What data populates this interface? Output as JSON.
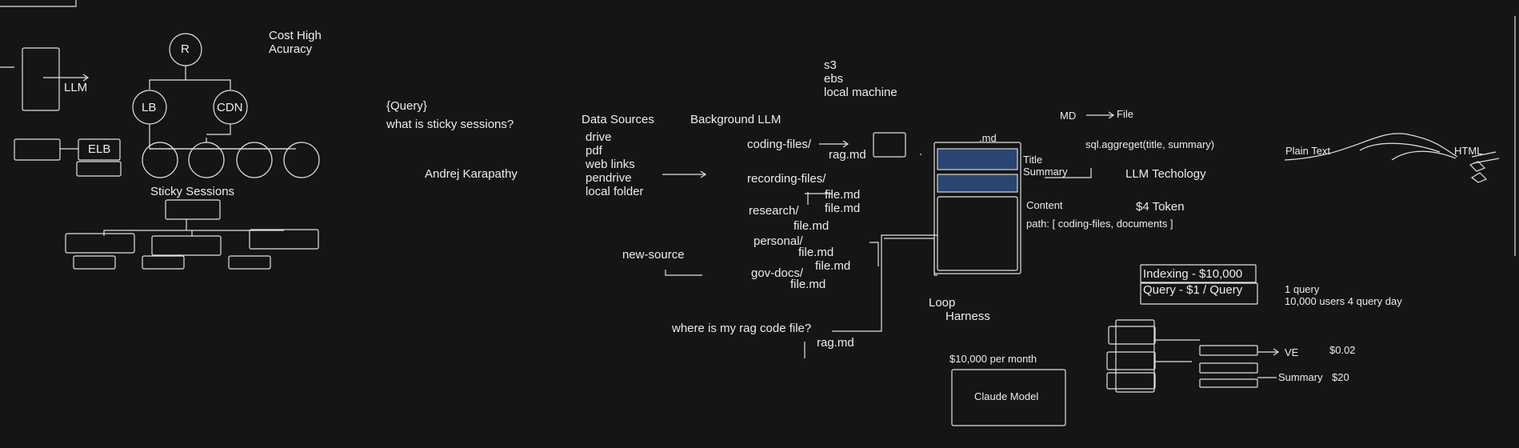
{
  "arch": {
    "llm": "LLM",
    "r": "R",
    "lb": "LB",
    "cdn": "CDN",
    "elb": "ELB",
    "cost": "Cost High\nAcuracy",
    "sticky": "Sticky Sessions"
  },
  "query": {
    "tag": "{Query}",
    "question": "what is sticky sessions?",
    "person": "Andrej Karapathy"
  },
  "sources": {
    "storage": "s3\nebs\nlocal machine",
    "title": "Data Sources",
    "items": "drive\npdf\nweb links\npendrive\nlocal folder",
    "new_source": "new-source",
    "background": "Background LLM"
  },
  "folders": {
    "coding": "coding-files/",
    "rag1": "rag.md",
    "recording": "recording-files/",
    "file1": "file.md\nfile.md",
    "research": "research/",
    "file2": "file.md",
    "personal": "personal/",
    "file3": "file.md",
    "file4": "file.md",
    "gov": "gov-docs/",
    "file5": "file.md",
    "where": "where is my rag code file?",
    "rag2": "rag.md"
  },
  "md": {
    "ext": ".md",
    "title_summary": "Title\nSummary",
    "content": "Content",
    "path": "path: [ coding-files, documents ]",
    "loop": "Loop",
    "harness": "Harness",
    "md_file_a": "MD",
    "md_file_b": "File",
    "sql": "sql.aggreget(title, summary)",
    "llm_tech": "LLM Techology",
    "token": "$4 Token"
  },
  "cost": {
    "indexing": "Indexing - $10,000",
    "query": "Query - $1 / Query",
    "users": "1 query\n10,000 users 4 query day",
    "per_month": "$10,000 per month",
    "claude": "Claude Model",
    "ve": "VE",
    "ve_price": "$0.02",
    "summary": "Summary",
    "summary_price": "$20"
  },
  "html_conv": {
    "plain": "Plain Text",
    "html": "HTML"
  },
  "colors": {
    "background": "#151515",
    "stroke": "#e6e6e6",
    "fill_blue": "#2a4570"
  }
}
